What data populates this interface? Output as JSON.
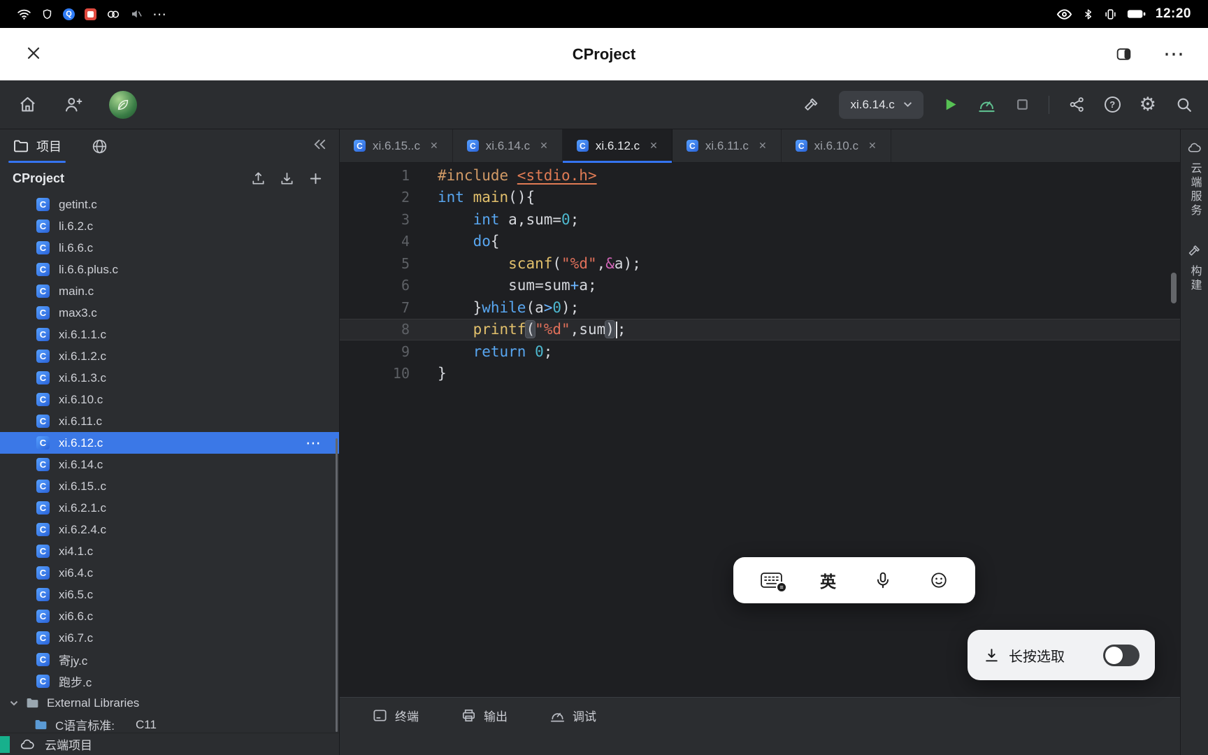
{
  "status_bar": {
    "time": "12:20",
    "left_icons": [
      "wifi-icon",
      "shield-app-icon",
      "q-app-icon",
      "red-app-icon",
      "rings-app-icon",
      "muted-speaker-icon"
    ],
    "more_label": "⋯",
    "right_icons": [
      "eye-icon",
      "bluetooth-icon",
      "vibrate-icon",
      "battery-icon"
    ]
  },
  "title_bar": {
    "title": "CProject",
    "window_controls": [
      "close-x-icon",
      "split-screen-icon",
      "more-dots-icon"
    ],
    "more_dots": "⋯"
  },
  "toolbar": {
    "left_icons": [
      "home-icon",
      "person-add-icon",
      "user-avatar"
    ],
    "run_target": "xi.6.14.c",
    "right_icons": [
      "hammer-icon",
      "run-target-select",
      "play-icon",
      "debug-icon",
      "stop-icon",
      "share-icon",
      "help-icon",
      "settings-gear-icon",
      "search-icon"
    ],
    "help_glyph": "?",
    "gear_glyph": "⚙"
  },
  "sidebar": {
    "panel_tab": "项目",
    "tab_icons": [
      "folder-icon",
      "globe-icon",
      "collapse-double-chevron-icon"
    ],
    "project_name": "CProject",
    "header_icons": [
      "upload-icon",
      "download-icon",
      "add-icon"
    ],
    "files": [
      "getint.c",
      "li.6.2.c",
      "li.6.6.c",
      "li.6.6.plus.c",
      "main.c",
      "max3.c",
      "xi.6.1.1.c",
      "xi.6.1.2.c",
      "xi.6.1.3.c",
      "xi.6.10.c",
      "xi.6.11.c",
      "xi.6.12.c",
      "xi.6.14.c",
      "xi.6.15..c",
      "xi.6.2.1.c",
      "xi.6.2.4.c",
      "xi4.1.c",
      "xi6.4.c",
      "xi6.5.c",
      "xi6.6.c",
      "xi6.7.c",
      "寄jy.c",
      "跑步.c"
    ],
    "selected_file": "xi.6.12.c",
    "selected_more": "⋯",
    "external_libraries_label": "External Libraries",
    "c_standard_label": "C语言标准:",
    "c_standard_value": "C11",
    "cloud_project_label": "云端项目"
  },
  "editor": {
    "tabs": [
      {
        "label": "xi.6.15..c",
        "active": false
      },
      {
        "label": "xi.6.14.c",
        "active": false
      },
      {
        "label": "xi.6.12.c",
        "active": true
      },
      {
        "label": "xi.6.11.c",
        "active": false
      },
      {
        "label": "xi.6.10.c",
        "active": false
      }
    ],
    "tab_close_glyph": "✕",
    "lines": [
      {
        "num": 1,
        "tokens": [
          [
            "pre",
            "#include "
          ],
          [
            "inc",
            "<stdio.h>"
          ]
        ]
      },
      {
        "num": 2,
        "tokens": [
          [
            "kw",
            "int"
          ],
          [
            "pl",
            " "
          ],
          [
            "fn",
            "main"
          ],
          [
            "pl",
            "(){"
          ]
        ]
      },
      {
        "num": 3,
        "tokens": [
          [
            "pl",
            "    "
          ],
          [
            "kw",
            "int"
          ],
          [
            "pl",
            " a,sum="
          ],
          [
            "num",
            "0"
          ],
          [
            "pl",
            ";"
          ]
        ]
      },
      {
        "num": 4,
        "tokens": [
          [
            "pl",
            "    "
          ],
          [
            "kw",
            "do"
          ],
          [
            "pl",
            "{"
          ]
        ]
      },
      {
        "num": 5,
        "tokens": [
          [
            "pl",
            "        "
          ],
          [
            "fn",
            "scanf"
          ],
          [
            "pl",
            "("
          ],
          [
            "str",
            "\"%d\""
          ],
          [
            "pl",
            ","
          ],
          [
            "op",
            "&"
          ],
          [
            "pl",
            "a);"
          ]
        ]
      },
      {
        "num": 6,
        "tokens": [
          [
            "pl",
            "        sum=sum"
          ],
          [
            "op2",
            "+"
          ],
          [
            "pl",
            "a;"
          ]
        ]
      },
      {
        "num": 7,
        "tokens": [
          [
            "pl",
            "    }"
          ],
          [
            "kw",
            "while"
          ],
          [
            "pl",
            "(a"
          ],
          [
            "op2",
            ">"
          ],
          [
            "num",
            "0"
          ],
          [
            "pl",
            ");"
          ]
        ]
      },
      {
        "num": 8,
        "current": true,
        "tokens": [
          [
            "pl",
            "    "
          ],
          [
            "fn",
            "printf"
          ],
          [
            "paren",
            "("
          ],
          [
            "str",
            "\"%d\""
          ],
          [
            "pl",
            ",sum"
          ],
          [
            "paren",
            ")"
          ],
          [
            "caret",
            ""
          ],
          [
            "pl",
            ";"
          ]
        ]
      },
      {
        "num": 9,
        "tokens": [
          [
            "pl",
            "    "
          ],
          [
            "kw",
            "return"
          ],
          [
            "pl",
            " "
          ],
          [
            "num",
            "0"
          ],
          [
            "pl",
            ";"
          ]
        ]
      },
      {
        "num": 10,
        "tokens": [
          [
            "pl",
            "}"
          ]
        ]
      }
    ]
  },
  "bottom_bar": {
    "items": [
      {
        "label": "终端",
        "icon": "terminal-icon"
      },
      {
        "label": "输出",
        "icon": "output-icon"
      },
      {
        "label": "调试",
        "icon": "debug-icon"
      }
    ]
  },
  "right_strip": {
    "items": [
      {
        "label": "云端服务",
        "icon": "cloud-service-icon"
      },
      {
        "label": "构建",
        "icon": "build-icon"
      }
    ]
  },
  "ime_bar": {
    "lang_label": "英",
    "icons": [
      "keyboard-icon",
      "language-toggle",
      "microphone-icon",
      "emoji-icon"
    ]
  },
  "selection_toggle": {
    "label": "长按选取",
    "icon": "download-select-icon",
    "on": false
  },
  "colors": {
    "accent_blue": "#3574f0",
    "selected_row_blue": "#3b78e7",
    "run_green": "#57c254",
    "editor_bg": "#1e1f22",
    "panel_bg": "#2b2d30",
    "status_bg": "#000000",
    "title_bg": "#ffffff",
    "cloud_teal": "#17b08c"
  }
}
